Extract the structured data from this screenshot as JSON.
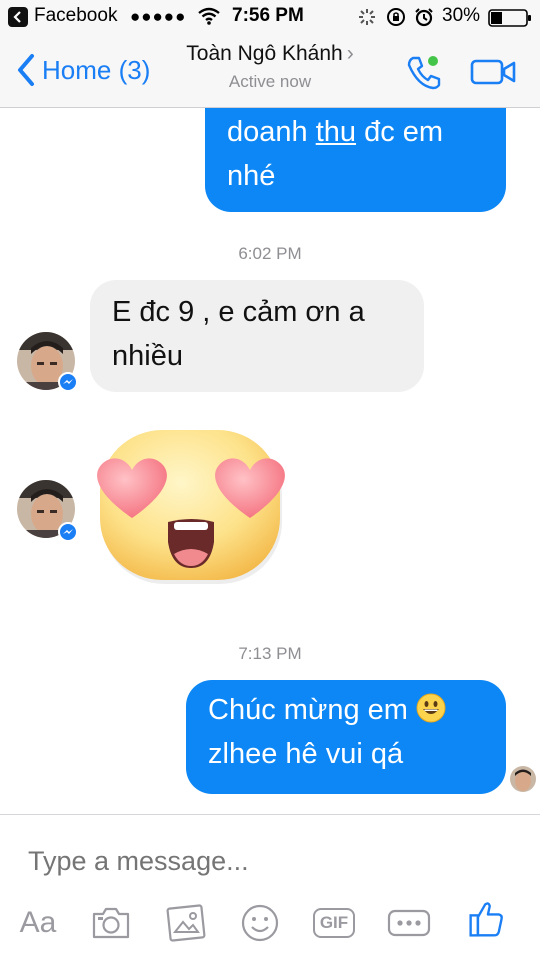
{
  "status_bar": {
    "carrier": "Facebook",
    "signal": "●●●●●",
    "time": "7:56 PM",
    "battery": "30%"
  },
  "header": {
    "back_label": "Home (3)",
    "contact_name": "Toàn Ngô Khánh",
    "contact_status": "Active now",
    "accent": "#1a7ef5"
  },
  "messages": {
    "m1_line1_a": "doanh ",
    "m1_line1_b": "thu",
    "m1_line1_c": " đc em",
    "m1_line2": "nhé",
    "time1": "6:02 PM",
    "m2_line1": "E đc 9 , e cảm ơn a",
    "m2_line2": "nhiều",
    "sticker": "heart-eyes-emoji-sticker",
    "time2": "7:13 PM",
    "m3_line1": "Chúc mừng em",
    "m3_line2": "zlhee hê vui qá"
  },
  "colors": {
    "outgoing_bubble": "#0d87f5",
    "incoming_bubble": "#f1f0f0"
  },
  "composer": {
    "placeholder": "Type a message...",
    "aa_label": "Aa",
    "gif_label": "GIF"
  }
}
